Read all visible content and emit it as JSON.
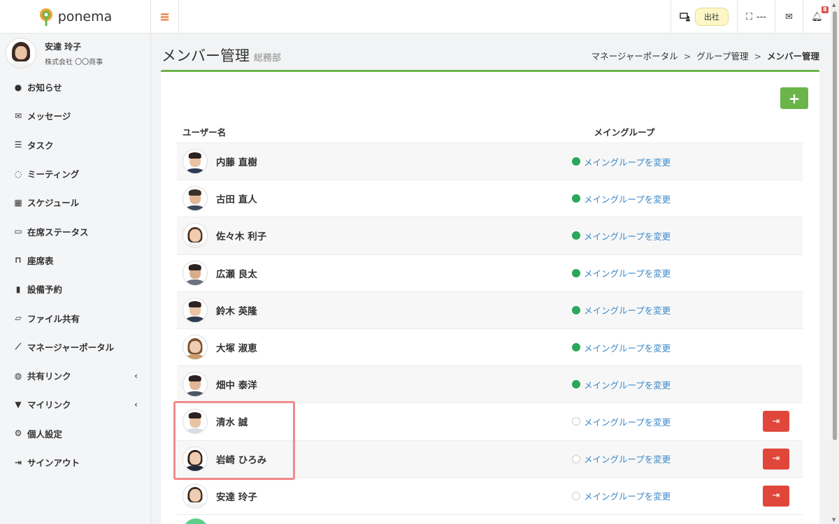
{
  "app": {
    "logo_text": "ponema",
    "brand_color": "#6bb44a",
    "accent_color": "#e8772e"
  },
  "header": {
    "status_label": "出社",
    "seat_label": "---",
    "notification_count": "8"
  },
  "profile": {
    "name": "安達 玲子",
    "company": "株式会社 〇〇商事"
  },
  "sidebar": {
    "items": [
      {
        "label": "お知らせ",
        "icon": "info-circle-icon"
      },
      {
        "label": "メッセージ",
        "icon": "envelope-icon"
      },
      {
        "label": "タスク",
        "icon": "list-check-icon"
      },
      {
        "label": "ミーティング",
        "icon": "comments-icon"
      },
      {
        "label": "スケジュール",
        "icon": "calendar-icon"
      },
      {
        "label": "在席ステータス",
        "icon": "presence-icon"
      },
      {
        "label": "座席表",
        "icon": "chair-icon"
      },
      {
        "label": "設備予約",
        "icon": "door-icon"
      },
      {
        "label": "ファイル共有",
        "icon": "folder-open-icon"
      },
      {
        "label": "マネージャーポータル",
        "icon": "line-chart-icon"
      },
      {
        "label": "共有リンク",
        "icon": "globe-icon"
      },
      {
        "label": "マイリンク",
        "icon": "bookmark-icon"
      },
      {
        "label": "個人設定",
        "icon": "gear-icon"
      },
      {
        "label": "サインアウト",
        "icon": "sign-out-icon"
      }
    ]
  },
  "page": {
    "title": "メンバー管理",
    "subtitle": "総務部",
    "breadcrumb": [
      "マネージャーポータル",
      "グループ管理",
      "メンバー管理"
    ],
    "breadcrumb_sep": ">"
  },
  "table": {
    "headers": {
      "user": "ユーザー名",
      "group": "メイングループ"
    },
    "change_label": "メイングループを変更",
    "rows": [
      {
        "name": "内藤 直樹",
        "main_group": true,
        "removable": false
      },
      {
        "name": "古田 直人",
        "main_group": true,
        "removable": false
      },
      {
        "name": "佐々木 利子",
        "main_group": true,
        "removable": false
      },
      {
        "name": "広瀬 良太",
        "main_group": true,
        "removable": false
      },
      {
        "name": "鈴木 英隆",
        "main_group": true,
        "removable": false
      },
      {
        "name": "大塚 淑恵",
        "main_group": true,
        "removable": false
      },
      {
        "name": "畑中 泰洋",
        "main_group": true,
        "removable": false
      },
      {
        "name": "清水 誠",
        "main_group": false,
        "removable": true
      },
      {
        "name": "岩崎 ひろみ",
        "main_group": false,
        "removable": true
      },
      {
        "name": "安達 玲子",
        "main_group": false,
        "removable": true
      }
    ]
  }
}
